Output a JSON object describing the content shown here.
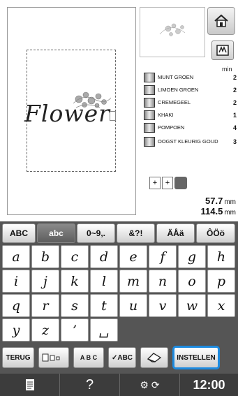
{
  "canvas": {
    "text": "Flower"
  },
  "header": {
    "min_label": "min"
  },
  "colors": [
    {
      "name": "MUNT GROEN",
      "value": "2"
    },
    {
      "name": "LIMOEN GROEN",
      "value": "2"
    },
    {
      "name": "CREMEGEEL",
      "value": "2"
    },
    {
      "name": "KHAKI",
      "value": "1"
    },
    {
      "name": "POMPOEN",
      "value": "4"
    },
    {
      "name": "OOGST KLEURIG GOUD",
      "value": "3"
    }
  ],
  "dimensions": {
    "height_value": "57.7",
    "width_value": "114.5",
    "unit": "mm"
  },
  "tabs": [
    "ABC",
    "abc",
    "0~9,.",
    "&?!",
    "ÄÅä",
    "ÔÖö"
  ],
  "keys": [
    [
      "a",
      "b",
      "c",
      "d",
      "e",
      "f",
      "g",
      "h"
    ],
    [
      "i",
      "j",
      "k",
      "l",
      "m",
      "n",
      "o",
      "p"
    ],
    [
      "q",
      "r",
      "s",
      "t",
      "u",
      "v",
      "w",
      "x"
    ],
    [
      "y",
      "z",
      "’",
      "␣"
    ]
  ],
  "bottom": {
    "back_label": "TERUG",
    "abc_check_label": "✓ABC",
    "set_label": "INSTELLEN",
    "abc_arc_label": "A B C"
  },
  "status": {
    "time": "12:00",
    "help_label": "?"
  },
  "icons": {
    "home": "home-icon",
    "memory": "memory-icon",
    "eraser": "eraser-icon",
    "document": "document-icon"
  }
}
